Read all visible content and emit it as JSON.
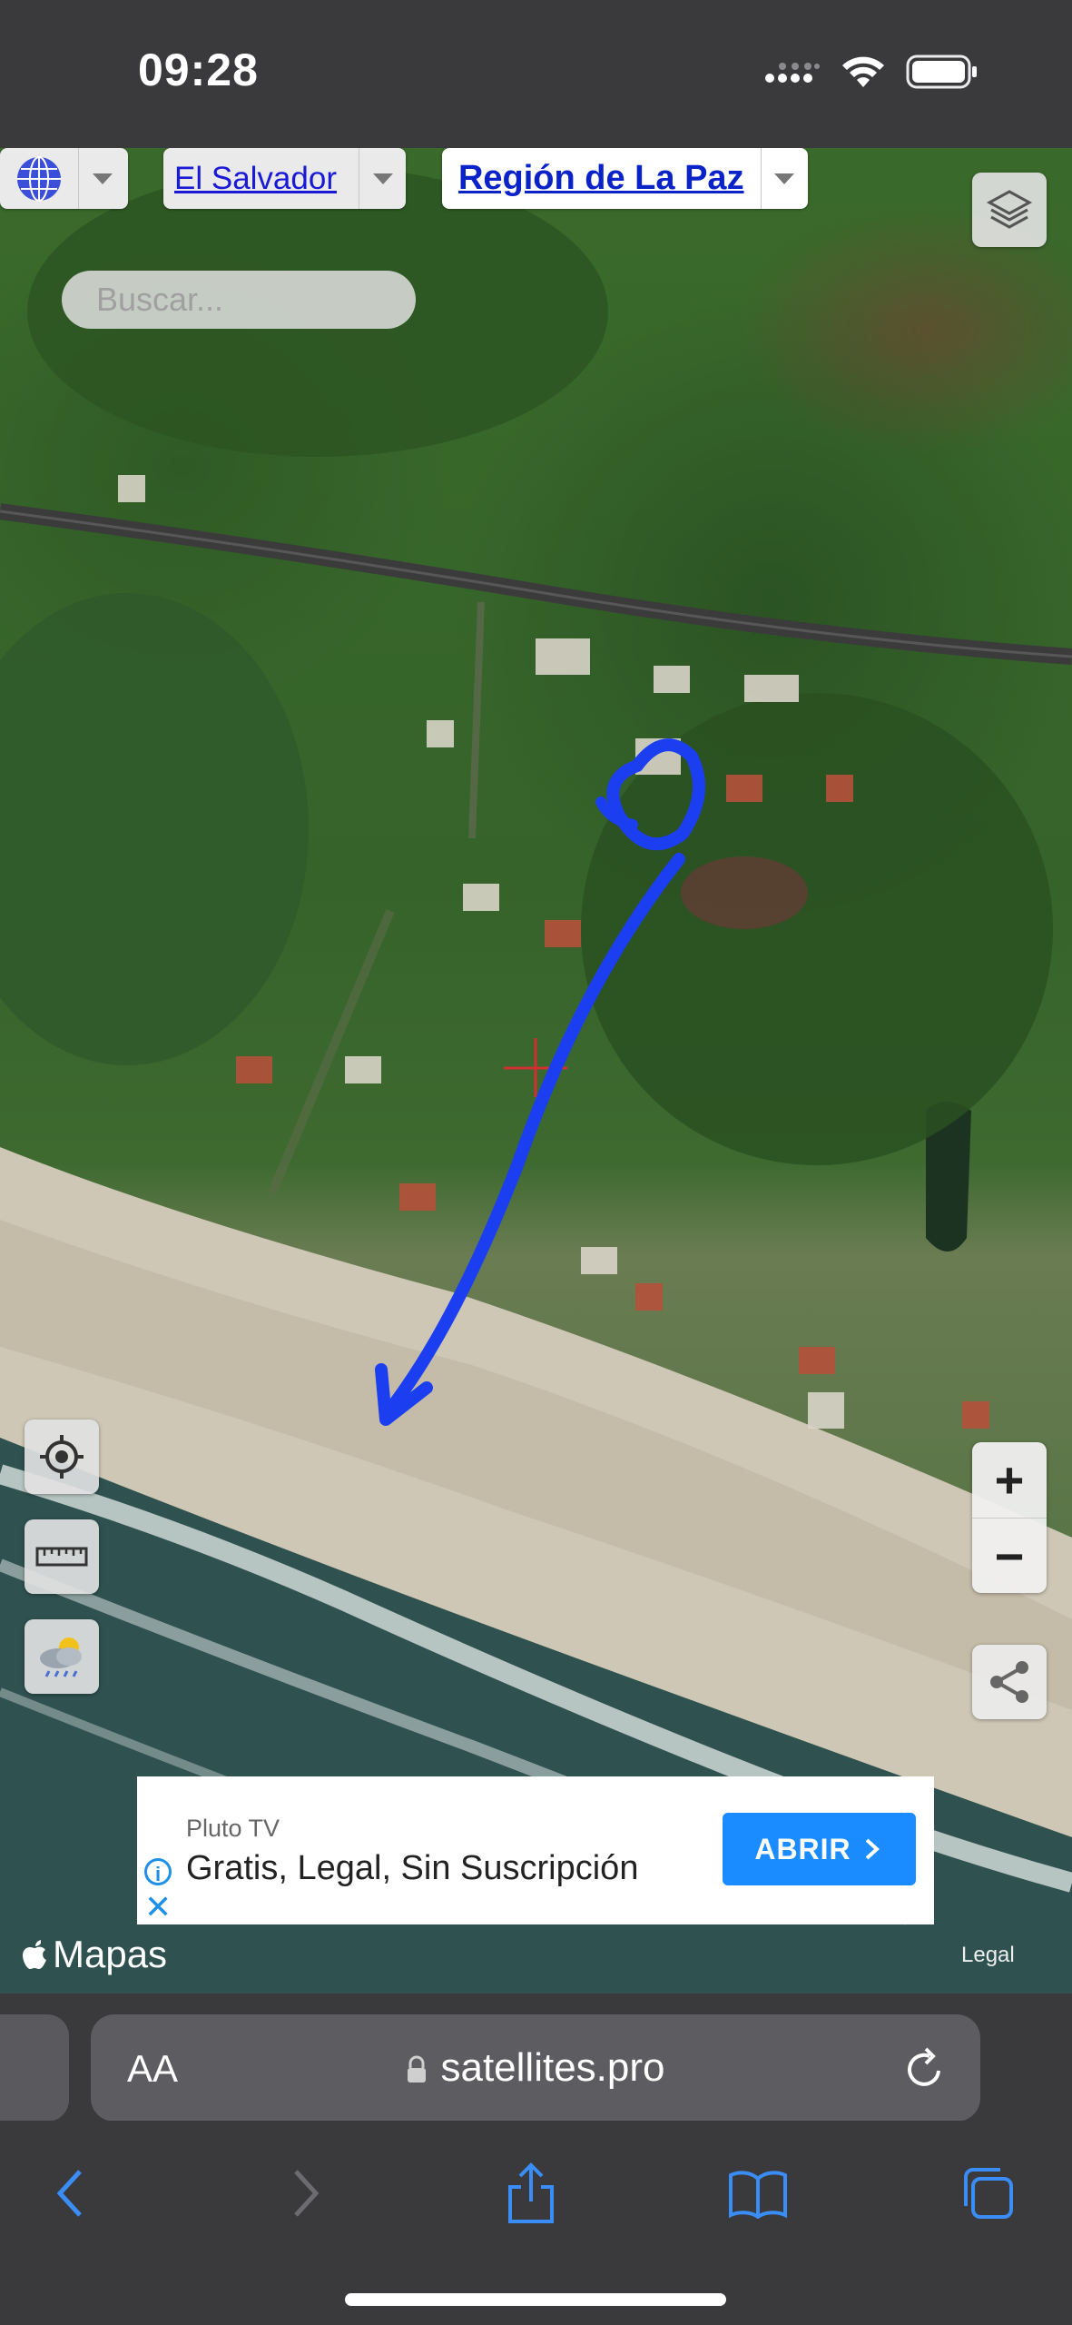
{
  "status_bar": {
    "time": "09:28"
  },
  "map": {
    "country_select": "El Salvador",
    "region_select": "Región de La Paz",
    "search": {
      "placeholder": "Buscar...",
      "value": ""
    },
    "zoom": {
      "in_label": "+",
      "out_label": "−"
    },
    "attribution": {
      "logo_text": "Mapas",
      "legal": "Legal"
    }
  },
  "ad": {
    "brand": "Pluto TV",
    "tagline": "Gratis, Legal, Sin Suscripción",
    "cta": "ABRIR",
    "close_symbol": "✕"
  },
  "browser": {
    "text_size_label": "AA",
    "url": "satellites.pro"
  },
  "colors": {
    "annotation": "#1b3ff0",
    "cta_blue": "#1a8cff",
    "chrome": "#3a3a3c",
    "safari_tint": "#3a8df7"
  },
  "icons": [
    "signal-icon",
    "wifi-icon",
    "battery-icon",
    "globe-icon",
    "layers-icon",
    "locate-icon",
    "ruler-icon",
    "weather-icon",
    "share-map-icon",
    "lock-icon",
    "reload-icon",
    "back-icon",
    "forward-icon",
    "share-icon",
    "bookmarks-icon",
    "tabs-icon"
  ]
}
